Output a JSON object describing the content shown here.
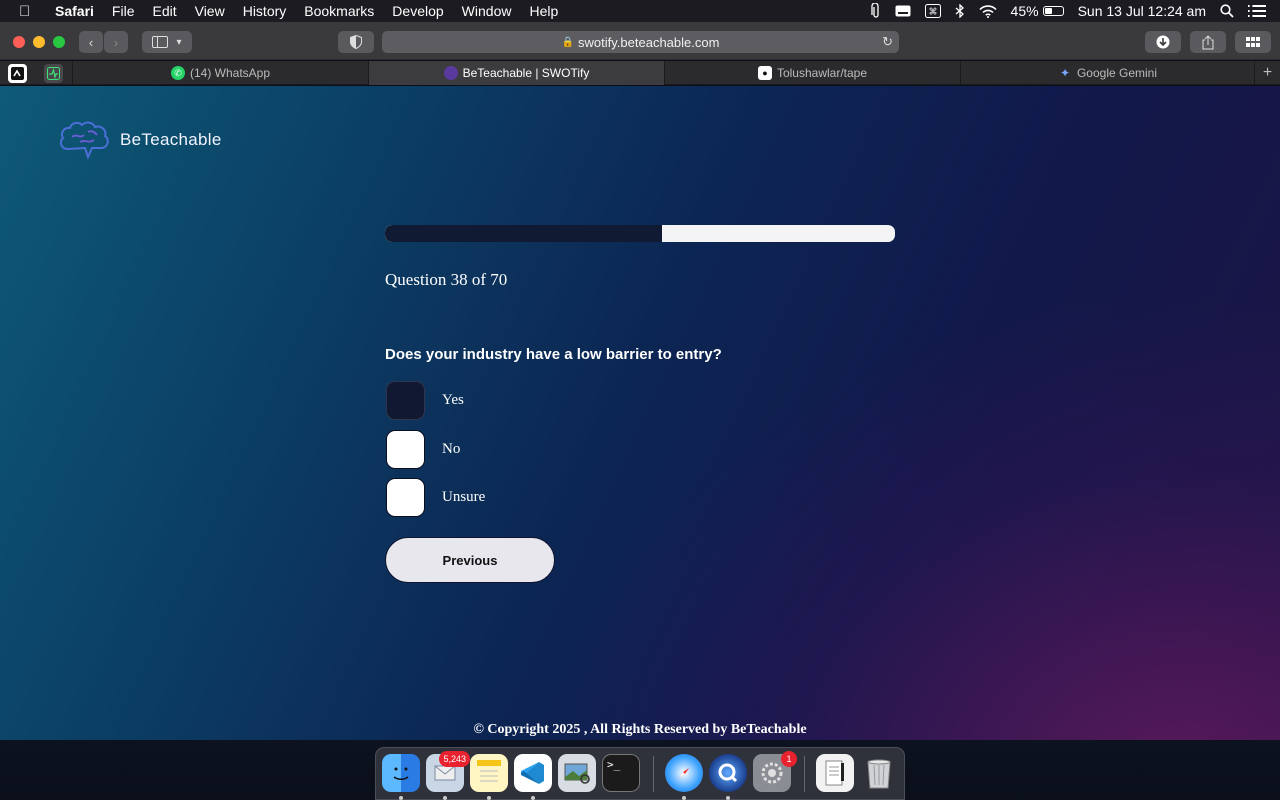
{
  "menubar": {
    "app_name": "Safari",
    "items": [
      "File",
      "Edit",
      "View",
      "History",
      "Bookmarks",
      "Develop",
      "Window",
      "Help"
    ],
    "battery": "45%",
    "battery_level": 0.45,
    "datetime": "Sun 13 Jul  12:24 am"
  },
  "toolbar": {
    "url": "swotify.beteachable.com"
  },
  "tabs": [
    {
      "title": "(14) WhatsApp",
      "icon": "whatsapp-icon"
    },
    {
      "title": "BeTeachable | SWOTify",
      "icon": "beteachable-icon",
      "active": true
    },
    {
      "title": "Tolushawlar/tape",
      "icon": "github-icon"
    },
    {
      "title": "Google Gemini",
      "icon": "gemini-icon"
    }
  ],
  "page": {
    "brand_name": "BeTeachable",
    "progress": {
      "current": 38,
      "total": 70,
      "fraction": 0.543
    },
    "question_counter": "Question 38 of 70",
    "question_text": "Does your industry have a low barrier to entry?",
    "options": [
      {
        "label": "Yes",
        "selected": true
      },
      {
        "label": "No",
        "selected": false
      },
      {
        "label": "Unsure",
        "selected": false
      }
    ],
    "previous_label": "Previous",
    "footer": "© Copyright 2025 , All Rights Reserved by BeTeachable"
  },
  "dock": {
    "mail_badge": "5,243",
    "settings_badge": "1",
    "apps": [
      "finder-icon",
      "mail-icon",
      "notes-icon",
      "vscode-icon",
      "preview-icon",
      "terminal-icon",
      "safari-icon",
      "quicktime-icon",
      "system-preferences-icon",
      "textedit-icon",
      "trash-icon"
    ]
  },
  "colors": {
    "progress_fill": "#111a33",
    "progress_track": "#f4f4f6",
    "page_bg_start": "#0e5a77",
    "page_bg_end": "#1d1545"
  }
}
